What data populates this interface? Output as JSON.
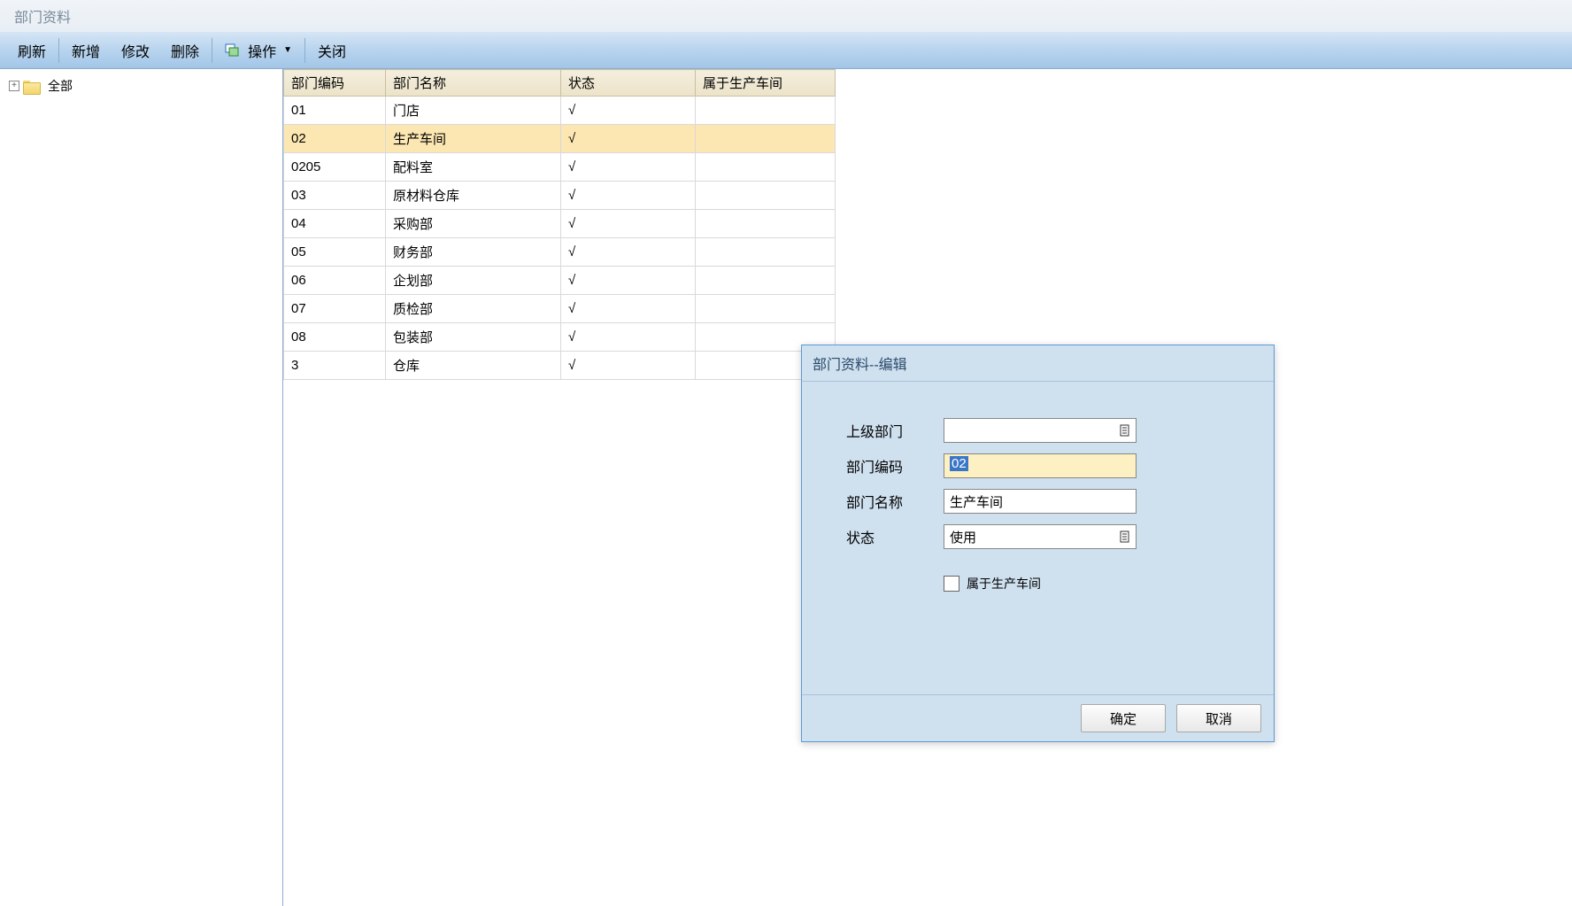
{
  "window_title": "部门资料",
  "toolbar": {
    "refresh": "刷新",
    "add": "新增",
    "edit": "修改",
    "delete": "删除",
    "operate": "操作",
    "close": "关闭"
  },
  "tree": {
    "root_label": "全部"
  },
  "grid": {
    "columns": {
      "code": "部门编码",
      "name": "部门名称",
      "status": "状态",
      "workshop": "属于生产车间"
    },
    "rows": [
      {
        "code": "01",
        "name": "门店",
        "status": "√",
        "workshop": ""
      },
      {
        "code": "02",
        "name": "生产车间",
        "status": "√",
        "workshop": ""
      },
      {
        "code": "0205",
        "name": "配料室",
        "status": "√",
        "workshop": ""
      },
      {
        "code": "03",
        "name": "原材料仓库",
        "status": "√",
        "workshop": ""
      },
      {
        "code": "04",
        "name": "采购部",
        "status": "√",
        "workshop": ""
      },
      {
        "code": "05",
        "name": "财务部",
        "status": "√",
        "workshop": ""
      },
      {
        "code": "06",
        "name": "企划部",
        "status": "√",
        "workshop": ""
      },
      {
        "code": "07",
        "name": "质检部",
        "status": "√",
        "workshop": ""
      },
      {
        "code": "08",
        "name": "包装部",
        "status": "√",
        "workshop": ""
      },
      {
        "code": "3",
        "name": "仓库",
        "status": "√",
        "workshop": ""
      }
    ],
    "selected_index": 1
  },
  "dialog": {
    "title": "部门资料--编辑",
    "labels": {
      "parent": "上级部门",
      "code": "部门编码",
      "name": "部门名称",
      "status": "状态",
      "workshop": "属于生产车间"
    },
    "values": {
      "parent": "",
      "code": "02",
      "name": "生产车间",
      "status": "使用",
      "workshop_checked": false
    },
    "buttons": {
      "ok": "确定",
      "cancel": "取消"
    }
  }
}
